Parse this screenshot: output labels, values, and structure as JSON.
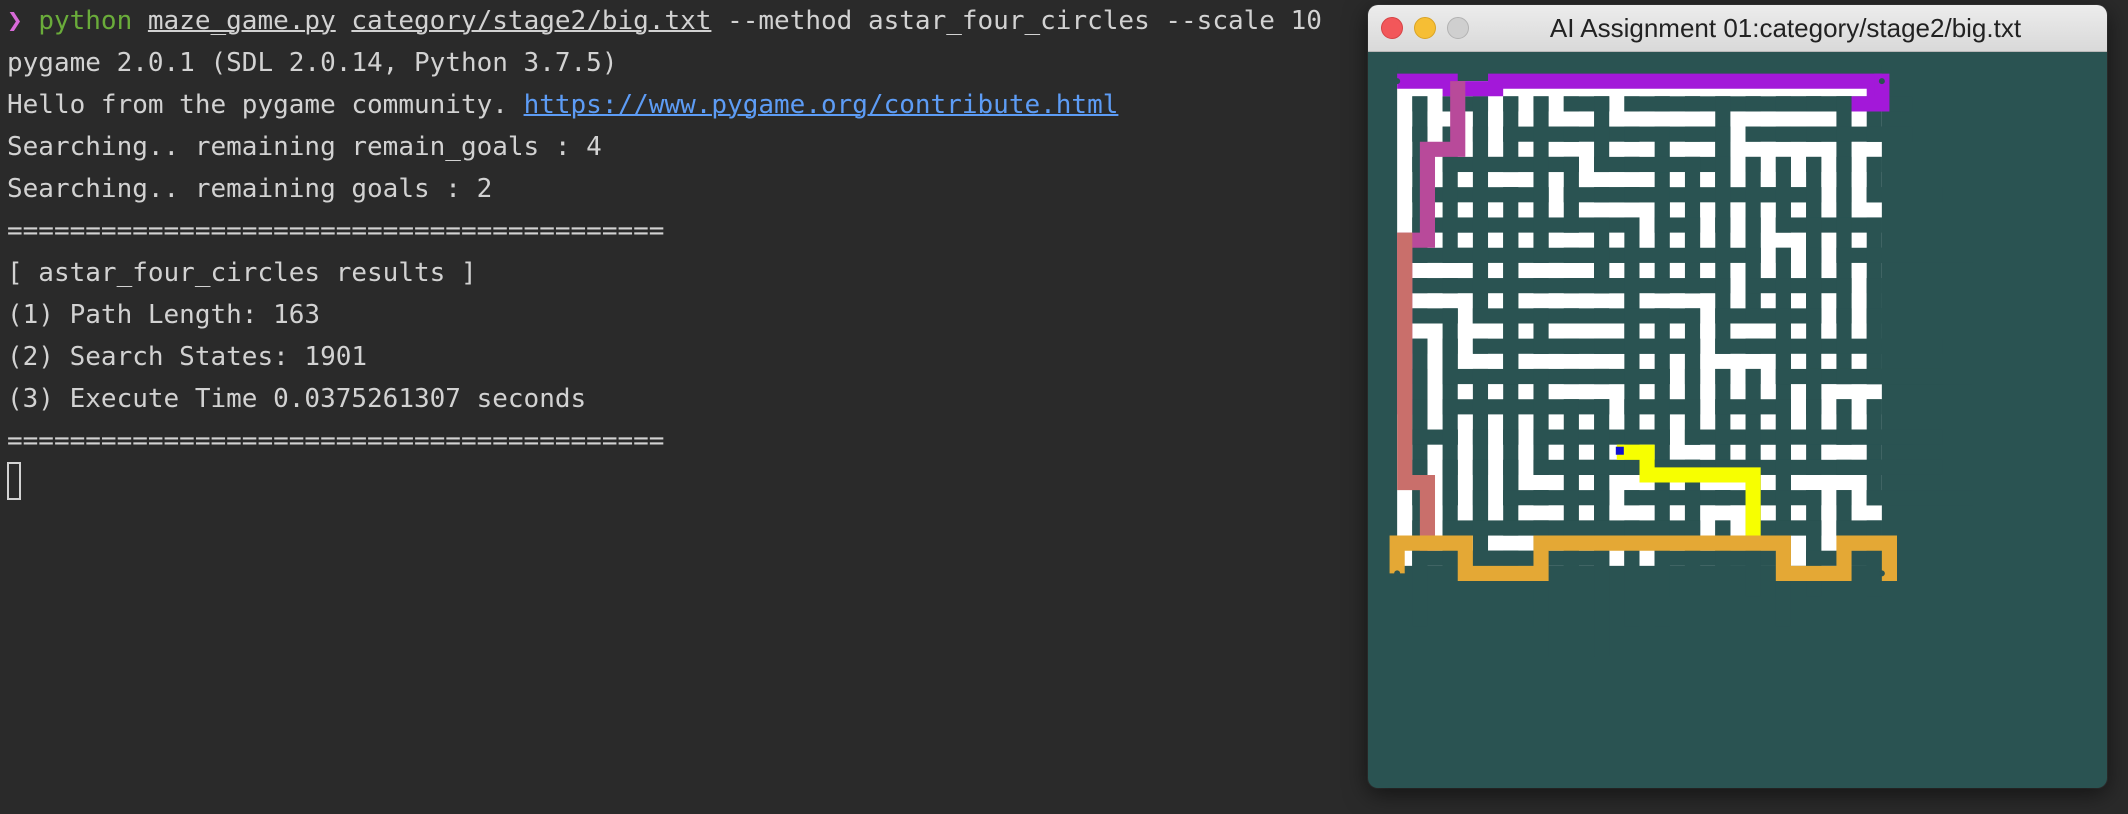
{
  "terminal": {
    "prompt_symbol": "❯",
    "command": {
      "program": "python",
      "script": "maze_game.py",
      "maze_file": "category/stage2/big.txt",
      "args": "--method astar_four_circles --scale 10"
    },
    "line_pygame_version": "pygame 2.0.1 (SDL 2.0.14, Python 3.7.5)",
    "hello_text": "Hello from the pygame community. ",
    "hello_link": "https://www.pygame.org/contribute.html",
    "line_remain_goals": "Searching.. remaining remain_goals : 4",
    "line_goals": "Searching.. remaining goals : 2",
    "separator": "==========================================",
    "results_header": "[ astar_four_circles results ]",
    "path_length_line": "(1) Path Length: 163",
    "search_states_line": "(2) Search States: 1901",
    "execute_time_line": "(3) Execute Time 0.0375261307 seconds"
  },
  "window": {
    "title": "AI Assignment 01:category/stage2/big.txt",
    "controls": [
      "close-icon",
      "minimize-icon",
      "maximize-icon"
    ]
  },
  "maze": {
    "colors": {
      "wall": "#2a5352",
      "floor": "#ffffff",
      "goal_dot": "#2a5352",
      "agent": "#1010d0",
      "path_start": "#f7ff00",
      "path_mid1": "#e4a835",
      "path_mid2": "#c96f6b",
      "path_end": "#a318d9"
    },
    "goals_total": 4,
    "goals_remaining": 2,
    "path_length": 163,
    "search_states": 1901
  }
}
